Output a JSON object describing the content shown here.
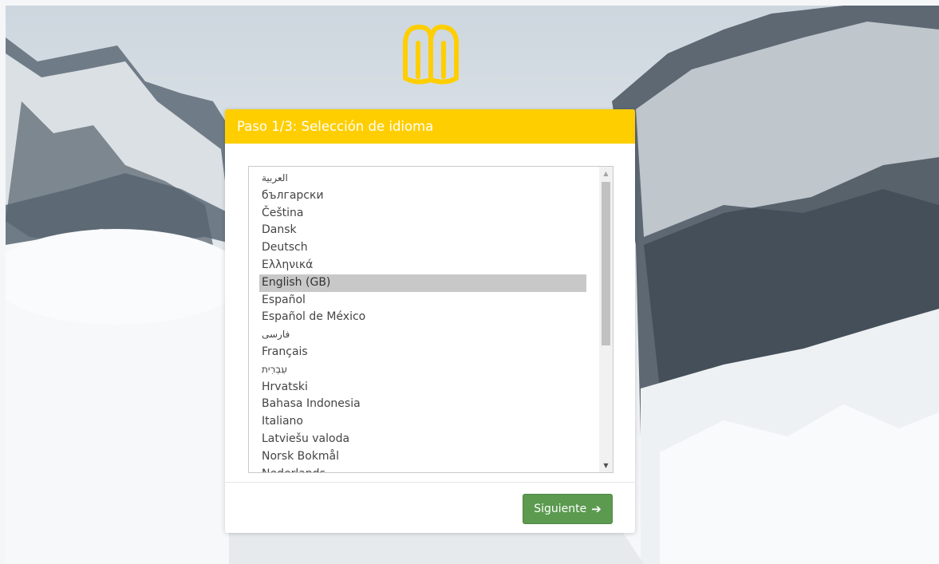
{
  "wizard": {
    "step_title": "Paso 1/3: Selección de idioma",
    "languages": [
      "العربية",
      "български",
      "Čeština",
      "Dansk",
      "Deutsch",
      "Ελληνικά",
      "English (GB)",
      "Español",
      "Español de México",
      "فارسی",
      "Français",
      "עִבְרִית",
      "Hrvatski",
      "Bahasa Indonesia",
      "Italiano",
      "Latviešu valoda",
      "Norsk Bokmål",
      "Nederlands"
    ],
    "selected_language": "English (GB)",
    "next_label": "Siguiente",
    "next_icon": "arrow-right-icon",
    "scroll_position": 0.0
  },
  "colors": {
    "header_bg": "#ffce00",
    "header_text": "#ffffff",
    "selected_bg": "#c8c8c8",
    "button_bg": "#5b9a4f",
    "logo": "#ffce00"
  }
}
